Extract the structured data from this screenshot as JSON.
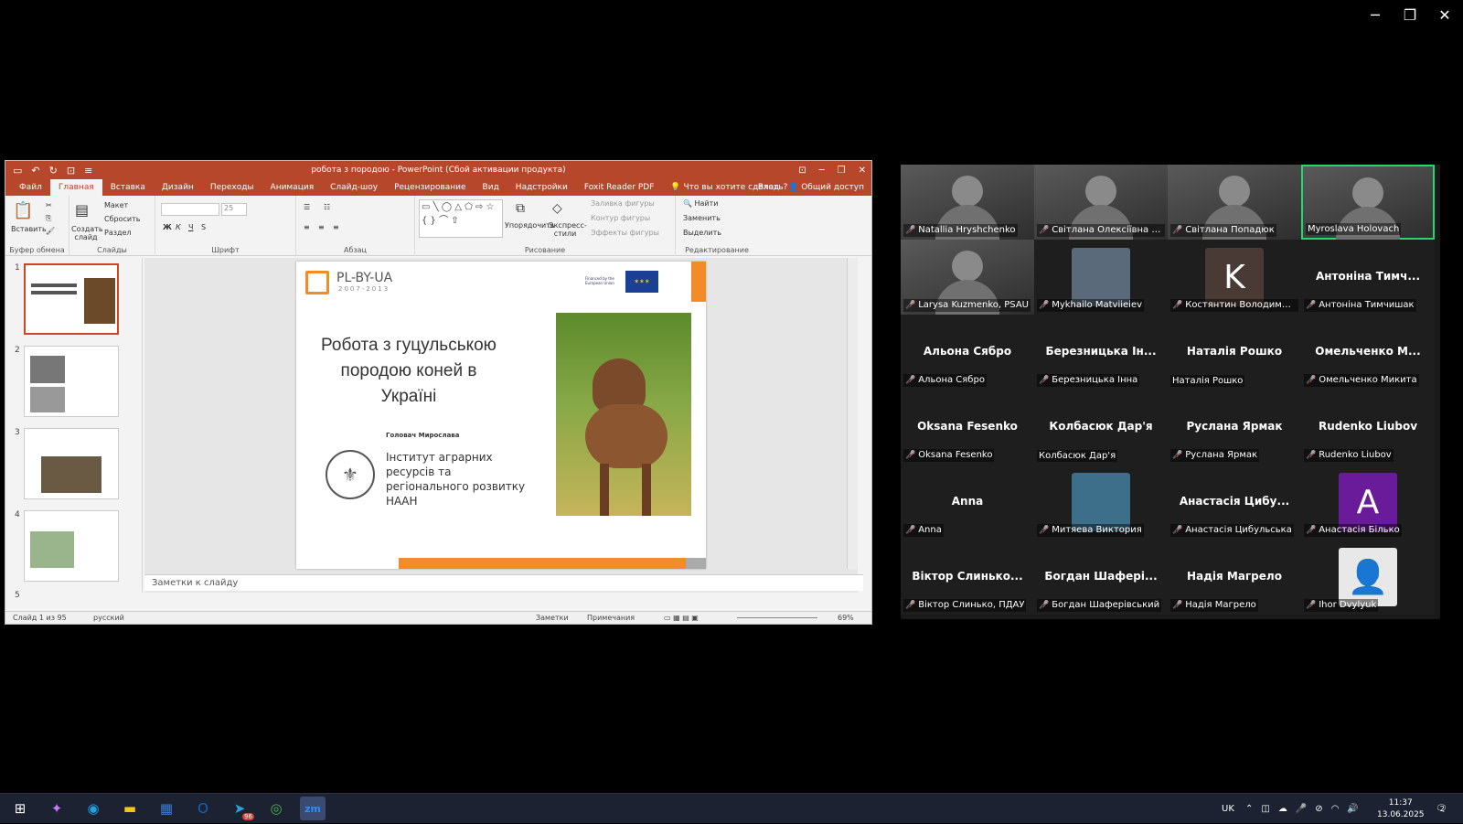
{
  "window": {
    "minimize": "─",
    "restore": "❐",
    "close": "✕"
  },
  "ppt": {
    "title": "робота з породою - PowerPoint (Сбой активации продукта)",
    "qa": [
      "▭",
      "↶",
      "↻",
      "⊡",
      "≡"
    ],
    "win_buttons": [
      "⊡",
      "─",
      "❐",
      "✕"
    ],
    "tabs": [
      "Файл",
      "Главная",
      "Вставка",
      "Дизайн",
      "Переходы",
      "Анимация",
      "Слайд-шоу",
      "Рецензирование",
      "Вид",
      "Надстройки",
      "Foxit Reader PDF"
    ],
    "tell_me": "Что вы хотите сделать?",
    "signin": "Вход",
    "share": "Общий доступ",
    "ribbon": {
      "paste": "Вставить",
      "clipboard": "Буфер обмена",
      "new_slide": "Создать слайд",
      "layout": "Макет",
      "reset": "Сбросить",
      "section": "Раздел",
      "slides": "Слайды",
      "font_size": "25",
      "font_group": "Шрифт",
      "paragraph": "Абзац",
      "arrange": "Упорядочить",
      "quick_styles": "Экспресс-стили",
      "fill": "Заливка фигуры",
      "outline": "Контур фигуры",
      "effects": "Эффекты фигуры",
      "drawing": "Рисование",
      "find": "Найти",
      "replace": "Заменить",
      "select": "Выделить",
      "editing": "Редактирование"
    },
    "slide_numbers": [
      "1",
      "2",
      "3",
      "4",
      "5"
    ],
    "slide": {
      "logo": "PL-BY-UA",
      "logo_years": "2007-2013",
      "eu_text": "Financed by the European Union",
      "title": "Робота з гуцульською породою коней в Україні",
      "author": "Головач Мирослава",
      "institute": "Інститут аграрних ресурсів та регіонального розвитку НААН"
    },
    "notes_placeholder": "Заметки к слайду",
    "status": {
      "slide": "Слайд 1 из 95",
      "lang": "русский",
      "notes": "Заметки",
      "comments": "Примечания",
      "zoom": "69%"
    }
  },
  "zoom": {
    "participants": [
      {
        "name": "Natallia Hryshchenko",
        "muted": true,
        "mode": "video"
      },
      {
        "name": "Світлана Олексіївна Усе...",
        "muted": true,
        "mode": "video"
      },
      {
        "name": "Світлана Попадюк",
        "muted": true,
        "mode": "video"
      },
      {
        "name": "Myroslava Holovach",
        "muted": false,
        "mode": "video",
        "speaking": true
      },
      {
        "name": "Larysa Kuzmenko, PSAU",
        "muted": true,
        "mode": "video"
      },
      {
        "name": "Mykhailo Matviieiev",
        "muted": true,
        "mode": "photo"
      },
      {
        "name": "Костянтин Володимиро...",
        "muted": true,
        "mode": "avatar",
        "initial": "K",
        "color": "#4a3a36"
      },
      {
        "name": "Антоніна Тимчишак",
        "display": "Антоніна Тимч...",
        "muted": true,
        "mode": "name"
      },
      {
        "name": "Альона Сябро",
        "display": "Альона Сябро",
        "muted": true,
        "mode": "name"
      },
      {
        "name": "Березницька Інна",
        "display": "Березницька Ін...",
        "muted": true,
        "mode": "name"
      },
      {
        "name": "Наталія Рошко",
        "display": "Наталія Рошко",
        "muted": false,
        "mode": "name"
      },
      {
        "name": "Омельченко Микита",
        "display": "Омельченко М...",
        "muted": true,
        "mode": "name"
      },
      {
        "name": "Oksana Fesenko",
        "display": "Oksana Fesenko",
        "muted": true,
        "mode": "name"
      },
      {
        "name": "Колбасюк Дар'я",
        "display": "Колбасюк Дар'я",
        "muted": false,
        "mode": "name"
      },
      {
        "name": "Руслана Ярмак",
        "display": "Руслана Ярмак",
        "muted": true,
        "mode": "name"
      },
      {
        "name": "Rudenko Liubov",
        "display": "Rudenko Liubov",
        "muted": true,
        "mode": "name"
      },
      {
        "name": "Anna",
        "display": "Anna",
        "muted": true,
        "mode": "name"
      },
      {
        "name": "Митяева Виктория",
        "muted": true,
        "mode": "photo",
        "color": "#3d6e8a"
      },
      {
        "name": "Анастасія Цибульська",
        "display": "Анастасія Цибу...",
        "muted": true,
        "mode": "name"
      },
      {
        "name": "Анастасія Білько",
        "muted": true,
        "mode": "avatar",
        "initial": "A",
        "color": "#6a1b9a"
      },
      {
        "name": "Віктор Слинько, ПДАУ",
        "display": "Віктор Слинько...",
        "muted": true,
        "mode": "name"
      },
      {
        "name": "Богдан Шаферівський",
        "display": "Богдан Шафері...",
        "muted": true,
        "mode": "name"
      },
      {
        "name": "Надія Магрело",
        "display": "Надія Магрело",
        "muted": true,
        "mode": "name"
      },
      {
        "name": "Ihor Dvylyuk",
        "muted": true,
        "mode": "avatar",
        "initial": "👤",
        "color": "#e8e8e8"
      }
    ]
  },
  "taskbar": {
    "start": "⊞",
    "apps": [
      {
        "name": "copilot-icon",
        "glyph": "✦",
        "color": "#c879ff"
      },
      {
        "name": "edge-icon",
        "glyph": "◉",
        "color": "#1fa2e6"
      },
      {
        "name": "file-explorer-icon",
        "glyph": "▬",
        "color": "#f5c518"
      },
      {
        "name": "store-icon",
        "glyph": "▦",
        "color": "#3a7bd5"
      },
      {
        "name": "outlook-icon",
        "glyph": "O",
        "color": "#1066c2"
      },
      {
        "name": "telegram-icon",
        "glyph": "➤",
        "color": "#2aa3e0",
        "badge": "96"
      },
      {
        "name": "chrome-icon",
        "glyph": "◎",
        "color": "#4caf50"
      },
      {
        "name": "zoom-icon",
        "glyph": "zm",
        "color": "#2d8cff",
        "active": true
      }
    ],
    "lang": "UK",
    "tray_icons": [
      "⌃",
      "◫",
      "☁",
      "🎤",
      "⊘",
      "◠",
      "🔊"
    ],
    "time": "11:37",
    "date": "13.06.2025",
    "notif_count": "2"
  }
}
